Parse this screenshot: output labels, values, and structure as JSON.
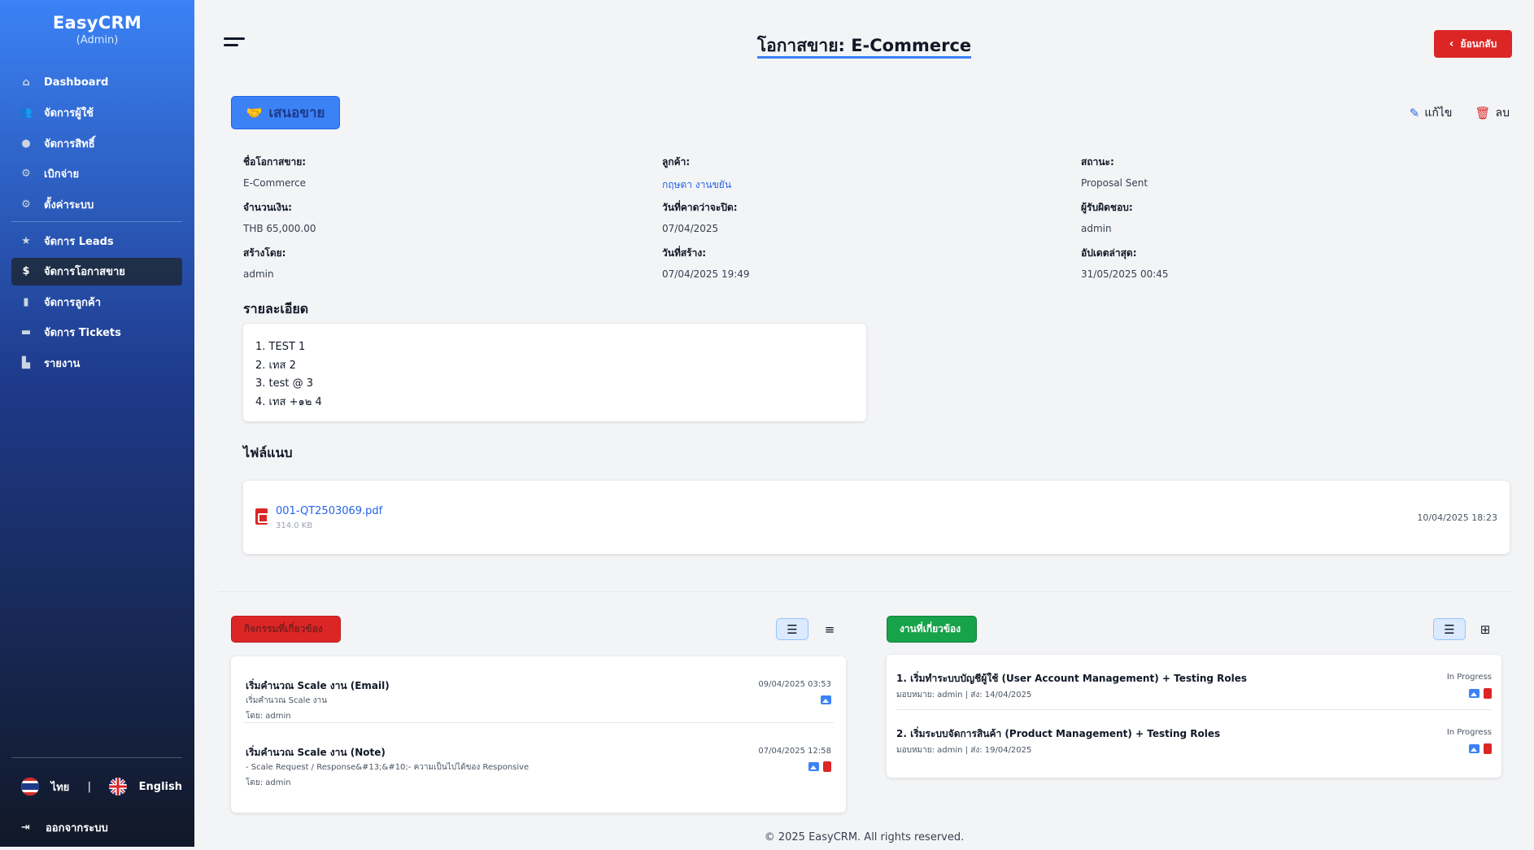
{
  "sidebar": {
    "brand": "EasyCRM",
    "role": "(Admin)",
    "items": [
      {
        "label": "Dashboard",
        "icon": "home-icon"
      },
      {
        "label": "จัดการผู้ใช้",
        "icon": "users-icon"
      },
      {
        "label": "จัดการสิทธิ์",
        "icon": "user-lock-icon"
      },
      {
        "label": "เบิกจ่าย",
        "icon": "gear-icon"
      },
      {
        "label": "ตั้งค่าระบบ",
        "icon": "gear-icon"
      },
      {
        "label": "จัดการ Leads",
        "icon": "star-icon"
      },
      {
        "label": "จัดการโอกาสขาย",
        "icon": "dollar-icon",
        "active": true
      },
      {
        "label": "จัดการลูกค้า",
        "icon": "building-icon"
      },
      {
        "label": "จัดการ Tickets",
        "icon": "ticket-icon"
      },
      {
        "label": "รายงาน",
        "icon": "chart-icon"
      }
    ],
    "lang_th": "ไทย",
    "lang_sep": "|",
    "lang_en": "English",
    "logout": "ออกจากระบบ"
  },
  "header": {
    "title": "โอกาสขาย: E-Commerce",
    "back_label": "ย้อนกลับ"
  },
  "opportunity": {
    "stage": "เสนอขาย",
    "edit_label": "แก้ไข",
    "delete_label": "ลบ",
    "fields": {
      "name_label": "ชื่อโอกาสขาย:",
      "name": "E-Commerce",
      "amount_label": "จำนวนเงิน:",
      "amount": "THB 65,000.00",
      "created_by_label": "สร้างโดย:",
      "created_by": "admin",
      "customer_label": "ลูกค้า:",
      "customer": "กฤษดา งานขยัน",
      "close_date_label": "วันที่คาดว่าจะปิด:",
      "close_date": "07/04/2025",
      "created_at_label": "วันที่สร้าง:",
      "created_at": "07/04/2025 19:49",
      "status_label": "สถานะ:",
      "status": "Proposal Sent",
      "owner_label": "ผู้รับผิดชอบ:",
      "owner": "admin",
      "updated_label": "อัปเดตล่าสุด:",
      "updated": "31/05/2025 00:45"
    },
    "details_heading": "รายละเอียด",
    "details": [
      "1. TEST 1",
      "2. เทส 2",
      "3. test @ 3",
      "4. เทส +๑๒ 4"
    ],
    "attachments_heading": "ไฟล์แนบ",
    "attachment": {
      "name": "001-QT2503069.pdf",
      "size": "314.0 KB",
      "date": "10/04/2025 18:23"
    }
  },
  "activities": {
    "tag": "กิจกรรมที่เกี่ยวข้อง",
    "items": [
      {
        "title": "เริ่มคำนวณ Scale งาน (Email)",
        "sub": "เริ่มคำนวณ Scale งาน",
        "by": "โดย: admin",
        "date": "09/04/2025 03:53"
      },
      {
        "title": "เริ่มคำนวณ Scale งาน (Note)",
        "sub": "- Scale Request / Response&#13;&#10;- ความเป็นไปได้ของ Responsive",
        "by": "โดย: admin",
        "date": "07/04/2025 12:58"
      }
    ]
  },
  "tasks": {
    "tag": "งานที่เกี่ยวข้อง",
    "items": [
      {
        "title": "1. เริ่มทำระบบบัญชีผู้ใช้ (User Account Management) + Testing Roles",
        "meta": "มอบหมาย: admin | ส่ง: 14/04/2025",
        "status": "In Progress"
      },
      {
        "title": "2. เริ่มระบบจัดการสินค้า (Product Management) + Testing Roles",
        "meta": "มอบหมาย: admin | ส่ง: 19/04/2025",
        "status": "In Progress"
      }
    ]
  },
  "footer": "© 2025 EasyCRM. All rights reserved.",
  "colors": {
    "primary": "#3b82f6",
    "danger": "#dc2626",
    "success": "#16a34a"
  }
}
